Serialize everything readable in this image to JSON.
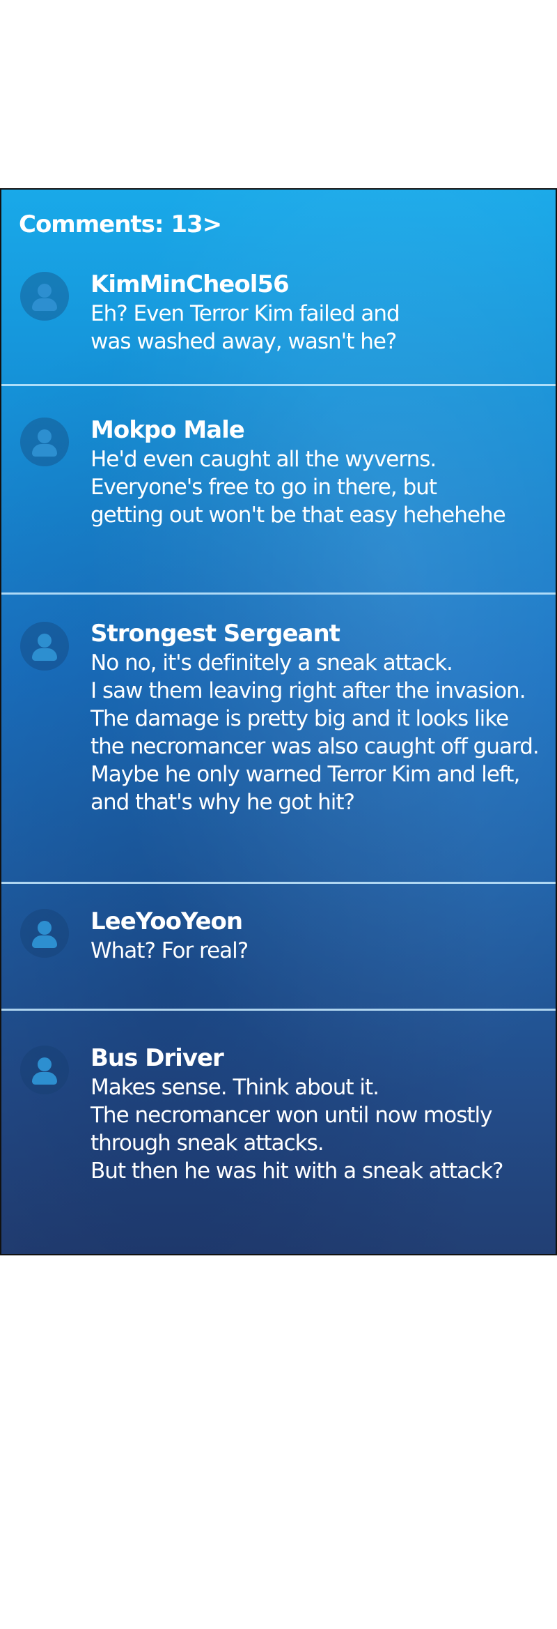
{
  "header": {
    "title": "Comments: 13>"
  },
  "comments": [
    {
      "name": "KimMinCheol56",
      "lines": [
        "Eh? Even Terror Kim failed and",
        "was washed away, wasn't he?"
      ]
    },
    {
      "name": "Mokpo Male",
      "lines": [
        "He'd even caught all the wyverns.",
        "Everyone's free to go in there, but",
        "getting out won't be that easy hehehehe"
      ]
    },
    {
      "name": "Strongest Sergeant",
      "lines": [
        "No no, it's definitely a sneak attack.",
        "I saw them leaving right after the invasion.",
        "The damage is pretty big and it looks like",
        "the necromancer was also caught off guard.",
        "Maybe he only warned Terror Kim and left,",
        "and that's why he got hit?"
      ]
    },
    {
      "name": "LeeYooYeon",
      "lines": [
        "What? For real?"
      ]
    },
    {
      "name": "Bus Driver",
      "lines": [
        "Makes sense. Think about it.",
        "The necromancer won until now mostly",
        "through sneak attacks.",
        "But then he was hit with a sneak attack?"
      ]
    }
  ],
  "icons": {
    "avatar": "user-avatar-icon"
  },
  "colors": {
    "panel_top": "#19a9e9",
    "panel_bottom": "#223f74",
    "text": "#ffffff",
    "divider": "#c8ebff"
  }
}
